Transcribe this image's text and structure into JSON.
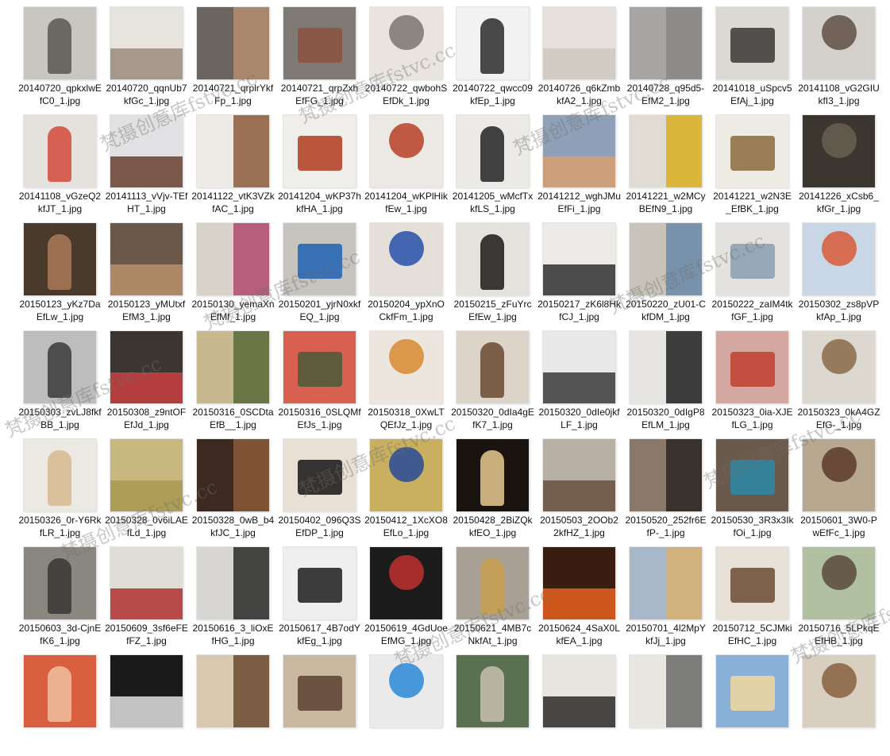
{
  "files": [
    {
      "name": "20140720_qpkxlwEfC0_1.jpg",
      "bg": "#c9c6c1",
      "accent": "#5a5652"
    },
    {
      "name": "20140720_qqnUb7kfGc_1.jpg",
      "bg": "#e7e3dd",
      "accent": "#9a8c7c"
    },
    {
      "name": "20140721_qrplrYkfFp_1.jpg",
      "bg": "#6b6560",
      "accent": "#b58c6d"
    },
    {
      "name": "20140721_qrpZxhEfFG_1.jpg",
      "bg": "#7f7a74",
      "accent": "#8c5240"
    },
    {
      "name": "20140722_qwbohSEfDk_1.jpg",
      "bg": "#e9e5de",
      "accent": "#7a7672"
    },
    {
      "name": "20140722_qwcc09kfEp_1.jpg",
      "bg": "#f2f2f2",
      "accent": "#2a2a2a"
    },
    {
      "name": "20140726_q6kZmbkfA2_1.jpg",
      "bg": "#e6e1da",
      "accent": "#cfc8bf"
    },
    {
      "name": "20140728_q95d5-EfM2_1.jpg",
      "bg": "#a8a6a3",
      "accent": "#8a8784"
    },
    {
      "name": "20141018_uSpcv5EfAj_1.jpg",
      "bg": "#dcd8d2",
      "accent": "#3a3836"
    },
    {
      "name": "20141108_vG2GIUkfI3_1.jpg",
      "bg": "#d4d0cc",
      "accent": "#5f4f45"
    },
    {
      "name": "20141108_vGzeQ2kfJT_1.jpg",
      "bg": "#e5e2dd",
      "accent": "#d44a3a"
    },
    {
      "name": "20141113_vVjv-TEfHT_1.jpg",
      "bg": "#e1e1e3",
      "accent": "#6a4030"
    },
    {
      "name": "20141122_vtK3VZkfAC_1.jpg",
      "bg": "#eeeae5",
      "accent": "#8a5a3a"
    },
    {
      "name": "20141204_wKP37hkfHA_1.jpg",
      "bg": "#f0eeeb",
      "accent": "#b03a20"
    },
    {
      "name": "20141204_wKPlHikfEw_1.jpg",
      "bg": "#ece9e4",
      "accent": "#b84028"
    },
    {
      "name": "20141205_wMcfTxkfLS_1.jpg",
      "bg": "#eceae7",
      "accent": "#222222"
    },
    {
      "name": "20141212_wghJMuEfFi_1.jpg",
      "bg": "#8fa0b8",
      "accent": "#d8a070"
    },
    {
      "name": "20141221_w2MCyBEfN9_1.jpg",
      "bg": "#e0dcd3",
      "accent": "#d8b020"
    },
    {
      "name": "20141221_w2N3E_EfBK_1.jpg",
      "bg": "#efece6",
      "accent": "#8a6a3a"
    },
    {
      "name": "20141226_xCsb6_kfGr_1.jpg",
      "bg": "#3b3630",
      "accent": "#6a5f52"
    },
    {
      "name": "20150123_yKz7DaEfLw_1.jpg",
      "bg": "#4a3a2c",
      "accent": "#a87a58"
    },
    {
      "name": "20150123_yMUtxfEfM3_1.jpg",
      "bg": "#6a5848",
      "accent": "#b8906a"
    },
    {
      "name": "20150130_yemaXnEfMf_1.jpg",
      "bg": "#d9d2c8",
      "accent": "#b04a70"
    },
    {
      "name": "20150201_yjrN0xkfEQ_1.jpg",
      "bg": "#c7c4c0",
      "accent": "#1f62b4"
    },
    {
      "name": "20150204_ypXnOCkfFm_1.jpg",
      "bg": "#e4e0d9",
      "accent": "#2850a8"
    },
    {
      "name": "20150215_zFuYrcEfEw_1.jpg",
      "bg": "#e6e3de",
      "accent": "#1a1a1a"
    },
    {
      "name": "20150217_zK6l8HkfCJ_1.jpg",
      "bg": "#ecebe8",
      "accent": "#303030"
    },
    {
      "name": "20150220_zU01-CkfDM_1.jpg",
      "bg": "#c8c3b8",
      "accent": "#6a8aa8"
    },
    {
      "name": "20150222_zaIM4tkfGF_1.jpg",
      "bg": "#e4e2de",
      "accent": "#8a9eb0"
    },
    {
      "name": "20150302_zs8pVPkfAp_1.jpg",
      "bg": "#c8d6e6",
      "accent": "#d85a38"
    },
    {
      "name": "20150303_zvLJ8fkfBB_1.jpg",
      "bg": "#bdbdbd",
      "accent": "#3a3a3a"
    },
    {
      "name": "20150308_z9ntOFEfJd_1.jpg",
      "bg": "#3c3632",
      "accent": "#c84040"
    },
    {
      "name": "20150316_0SCDtaEfB__1.jpg",
      "bg": "#c8b890",
      "accent": "#5a6a3a"
    },
    {
      "name": "20150316_0SLQMfEfJs_1.jpg",
      "bg": "#d86050",
      "accent": "#4a5a3a"
    },
    {
      "name": "20150318_0XwLTQEfJz_1.jpg",
      "bg": "#ece6de",
      "accent": "#d88a30"
    },
    {
      "name": "20150320_0dIa4gEfK7_1.jpg",
      "bg": "#dcd4c8",
      "accent": "#6a4a32"
    },
    {
      "name": "20150320_0dIe0jkfLF_1.jpg",
      "bg": "#e8e8e8",
      "accent": "#3a3a3a"
    },
    {
      "name": "20150320_0dIgP8EfLM_1.jpg",
      "bg": "#e6e5e2",
      "accent": "#1e1e1e"
    },
    {
      "name": "20150323_0ia-XJEfLG_1.jpg",
      "bg": "#d4a8a0",
      "accent": "#c04030"
    },
    {
      "name": "20150323_0kA4GZEfG-_1.jpg",
      "bg": "#dcd8d0",
      "accent": "#8a6a48"
    },
    {
      "name": "20150326_0r-Y6RkfLR_1.jpg",
      "bg": "#ece8e2",
      "accent": "#d8b890"
    },
    {
      "name": "20150328_0v6iLAEfLd_1.jpg",
      "bg": "#c8b880",
      "accent": "#a89850"
    },
    {
      "name": "20150328_0wB_b4kfJC_1.jpg",
      "bg": "#3c2a22",
      "accent": "#8a5a3a"
    },
    {
      "name": "20150402_096Q3SEfDP_1.jpg",
      "bg": "#e8e0d4",
      "accent": "#141414"
    },
    {
      "name": "20150412_1XcXO8EfLo_1.jpg",
      "bg": "#c8b060",
      "accent": "#284a98"
    },
    {
      "name": "20150428_2BiZQkkfEO_1.jpg",
      "bg": "#1a1410",
      "accent": "#e8c890"
    },
    {
      "name": "20150503_2OOb22kfHZ_1.jpg",
      "bg": "#b8b0a4",
      "accent": "#6a5040"
    },
    {
      "name": "20150520_252fr6EfP-_1.jpg",
      "bg": "#8a7868",
      "accent": "#2a2422"
    },
    {
      "name": "20150530_3R3x3IkfOi_1.jpg",
      "bg": "#6a5a4c",
      "accent": "#2a8aa8"
    },
    {
      "name": "20150601_3W0-PwEfFc_1.jpg",
      "bg": "#b8a890",
      "accent": "#5a3a2a"
    },
    {
      "name": "20150603_3d-CjnEfK6_1.jpg",
      "bg": "#8a8680",
      "accent": "#3a3634"
    },
    {
      "name": "20150609_3sf6eFEfFZ_1.jpg",
      "bg": "#e0dcd6",
      "accent": "#b03030"
    },
    {
      "name": "20150616_3_liOxEfHG_1.jpg",
      "bg": "#d8d6d2",
      "accent": "#2a2a2a"
    },
    {
      "name": "20150617_4B7odYkfEg_1.jpg",
      "bg": "#efefef",
      "accent": "#1c1c1c"
    },
    {
      "name": "20150619_4GdUoeEfMG_1.jpg",
      "bg": "#1c1c1c",
      "accent": "#c03030"
    },
    {
      "name": "20150621_4MB7cNkfAt_1.jpg",
      "bg": "#a8a094",
      "accent": "#c8a050"
    },
    {
      "name": "20150624_4SaX0LkfEA_1.jpg",
      "bg": "#3a1c10",
      "accent": "#e86020"
    },
    {
      "name": "20150701_4l2MpYkfJj_1.jpg",
      "bg": "#a8b8c8",
      "accent": "#d8b070"
    },
    {
      "name": "20150712_5CJMkiEfHC_1.jpg",
      "bg": "#e6e0d6",
      "accent": "#6a4a32"
    },
    {
      "name": "20150716_5LPkqEEfHB_1.jpg",
      "bg": "#b0c0a0",
      "accent": "#5a4a3a"
    },
    {
      "name": "",
      "bg": "#d86040",
      "accent": "#f0c0a0"
    },
    {
      "name": "",
      "bg": "#1a1a1a",
      "accent": "#e0e0e0"
    },
    {
      "name": "",
      "bg": "#d8c8b0",
      "accent": "#6a4a30"
    },
    {
      "name": "",
      "bg": "#c8b8a0",
      "accent": "#5a4030"
    },
    {
      "name": "",
      "bg": "#eaeaea",
      "accent": "#2a8ad8"
    },
    {
      "name": "",
      "bg": "#5a7050",
      "accent": "#c8c0b0"
    },
    {
      "name": "",
      "bg": "#e8e4de",
      "accent": "#2a2a2a"
    },
    {
      "name": "",
      "bg": "#eae6e0",
      "accent": "#6a6a6a"
    },
    {
      "name": "",
      "bg": "#8ab0d8",
      "accent": "#f0d8a0"
    },
    {
      "name": "",
      "bg": "#d8cfc0",
      "accent": "#8a6040"
    }
  ],
  "watermarks": [
    {
      "text": "梵摄创意库fstvc.cc"
    },
    {
      "text": "梵摄创意库fstvc.cc"
    },
    {
      "text": "梵摄创意库fstvc.cc"
    },
    {
      "text": "梵摄创意库fstvc.cc"
    },
    {
      "text": "梵摄创意库fstvc.cc"
    },
    {
      "text": "梵摄创意库fstvc.cc"
    },
    {
      "text": "梵摄创意库fstvc.cc"
    },
    {
      "text": "梵摄创意库fstvc.cc"
    },
    {
      "text": "梵摄创意库fstvc.cc"
    },
    {
      "text": "梵摄创意库fstvc.cc"
    },
    {
      "text": "梵摄创意库fstvc.cc"
    }
  ]
}
